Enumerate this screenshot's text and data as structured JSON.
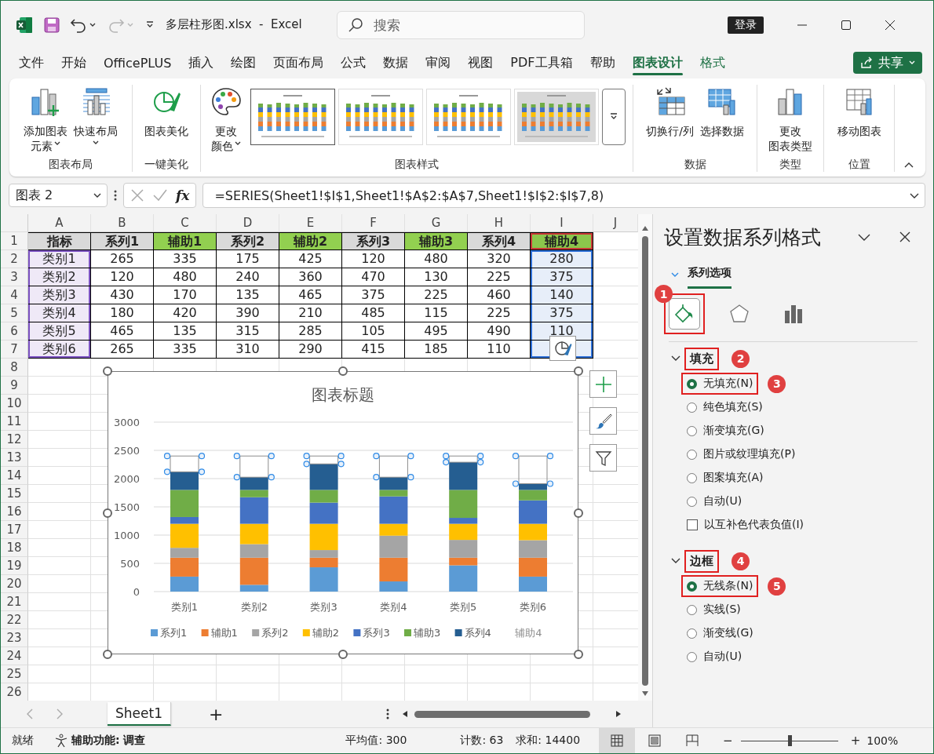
{
  "window": {
    "title": "多层柱形图.xlsx  -  Excel",
    "redo_disabled": true,
    "search": {
      "placeholder": "搜索"
    },
    "sign_in": "登录"
  },
  "menu": {
    "tabs": [
      {
        "label": "文件",
        "selected": false,
        "kind": "normal"
      },
      {
        "label": "开始",
        "selected": false,
        "kind": "normal"
      },
      {
        "label": "OfficePLUS",
        "selected": false,
        "kind": "normal"
      },
      {
        "label": "插入",
        "selected": false,
        "kind": "normal"
      },
      {
        "label": "绘图",
        "selected": false,
        "kind": "normal"
      },
      {
        "label": "页面布局",
        "selected": false,
        "kind": "normal"
      },
      {
        "label": "公式",
        "selected": false,
        "kind": "normal"
      },
      {
        "label": "数据",
        "selected": false,
        "kind": "normal"
      },
      {
        "label": "审阅",
        "selected": false,
        "kind": "normal"
      },
      {
        "label": "视图",
        "selected": false,
        "kind": "normal"
      },
      {
        "label": "PDF工具箱",
        "selected": false,
        "kind": "normal"
      },
      {
        "label": "帮助",
        "selected": false,
        "kind": "normal"
      },
      {
        "label": "图表设计",
        "selected": true,
        "kind": "contextual"
      },
      {
        "label": "格式",
        "selected": false,
        "kind": "contextual"
      }
    ],
    "share": "共享"
  },
  "ribbon": {
    "groups": [
      {
        "label": "图表布局",
        "buttons": [
          {
            "kind": "add-element",
            "lines": [
              "添加图表",
              "元素"
            ],
            "dropdown": true
          },
          {
            "kind": "quick-layout",
            "lines": [
              "快速布局"
            ],
            "dropdown": true
          }
        ]
      },
      {
        "label": "一键美化",
        "buttons": [
          {
            "kind": "beautify",
            "lines": [
              "图表美化"
            ],
            "dropdown": false
          }
        ]
      },
      {
        "label": "图表样式",
        "buttons": [
          {
            "kind": "color",
            "lines": [
              "更改",
              "颜色"
            ],
            "dropdown": true
          }
        ],
        "gallery": [
          {
            "selected": true
          },
          {
            "selected": false
          },
          {
            "selected": false
          },
          {
            "selected": false
          }
        ]
      },
      {
        "label": "数据",
        "buttons": [
          {
            "kind": "switch",
            "lines": [
              "切换行/列"
            ],
            "dropdown": false
          },
          {
            "kind": "select-data",
            "lines": [
              "选择数据"
            ],
            "dropdown": false
          }
        ]
      },
      {
        "label": "类型",
        "buttons": [
          {
            "kind": "change-type",
            "lines": [
              "更改",
              "图表类型"
            ],
            "dropdown": false
          }
        ]
      },
      {
        "label": "位置",
        "buttons": [
          {
            "kind": "move-chart",
            "lines": [
              "移动图表"
            ],
            "dropdown": false
          }
        ]
      }
    ]
  },
  "formula_bar": {
    "name_box": "图表 2",
    "function_label": "fx",
    "formula": "=SERIES(Sheet1!$I$1,Sheet1!$A$2:$A$7,Sheet1!$I$2:$I$7,8)"
  },
  "table": {
    "columns": [
      {
        "label": "A",
        "kind": "category-range"
      },
      {
        "label": "B"
      },
      {
        "label": "C"
      },
      {
        "label": "D"
      },
      {
        "label": "E"
      },
      {
        "label": "F"
      },
      {
        "label": "G"
      },
      {
        "label": "H"
      },
      {
        "label": "I",
        "kind": "value-range"
      },
      {
        "label": "J"
      }
    ],
    "header": {
      "num": "1",
      "cells": [
        {
          "text": "指标",
          "color": "#d9d9d9"
        },
        {
          "text": "系列1",
          "color": "#d9d9d9"
        },
        {
          "text": "辅助1",
          "color": "#92d050"
        },
        {
          "text": "系列2",
          "color": "#d9d9d9"
        },
        {
          "text": "辅助2",
          "color": "#92d050"
        },
        {
          "text": "系列3",
          "color": "#d9d9d9"
        },
        {
          "text": "辅助3",
          "color": "#92d050"
        },
        {
          "text": "系列4",
          "color": "#d9d9d9"
        },
        {
          "text": "辅助4",
          "color": "#92d050"
        }
      ]
    },
    "rows": [
      {
        "num": "2",
        "cells": [
          "类别1",
          "265",
          "335",
          "175",
          "425",
          "120",
          "480",
          "320",
          "280"
        ]
      },
      {
        "num": "3",
        "cells": [
          "类别2",
          "120",
          "480",
          "240",
          "360",
          "470",
          "130",
          "225",
          "375"
        ]
      },
      {
        "num": "4",
        "cells": [
          "类别3",
          "430",
          "170",
          "135",
          "465",
          "375",
          "225",
          "460",
          "140"
        ]
      },
      {
        "num": "5",
        "cells": [
          "类别4",
          "180",
          "420",
          "390",
          "210",
          "485",
          "115",
          "225",
          "375"
        ]
      },
      {
        "num": "6",
        "cells": [
          "类别5",
          "465",
          "135",
          "315",
          "285",
          "105",
          "495",
          "490",
          "110"
        ]
      },
      {
        "num": "7",
        "cells": [
          "类别6",
          "265",
          "335",
          "310",
          "290",
          "415",
          "185",
          "110"
        ]
      }
    ],
    "empty_rows": [
      "8",
      "9",
      "10",
      "11",
      "12",
      "13",
      "14",
      "15",
      "16",
      "17",
      "18",
      "19",
      "20",
      "21",
      "22",
      "23",
      "24",
      "25",
      "26"
    ]
  },
  "chart": {
    "series_filled": [
      true,
      true,
      true,
      true,
      true,
      true,
      true,
      false
    ],
    "chart_data": {
      "type": "bar",
      "stacked": true,
      "grid": true,
      "legend": true,
      "title": "图表标题",
      "categories": [
        "类别1",
        "类别2",
        "类别3",
        "类别4",
        "类别5",
        "类别6"
      ],
      "ylim": [
        0,
        3000
      ],
      "yticks": [
        0,
        500,
        1000,
        1500,
        2000,
        2500,
        3000
      ],
      "series": [
        {
          "name": "系列1",
          "color": "#5b9bd5",
          "values": [
            265,
            120,
            430,
            180,
            465,
            265
          ]
        },
        {
          "name": "辅助1",
          "color": "#ed7d31",
          "values": [
            335,
            480,
            170,
            420,
            135,
            335
          ]
        },
        {
          "name": "系列2",
          "color": "#a5a5a5",
          "values": [
            175,
            240,
            135,
            390,
            315,
            310
          ]
        },
        {
          "name": "辅助2",
          "color": "#ffc000",
          "values": [
            425,
            360,
            465,
            210,
            285,
            290
          ]
        },
        {
          "name": "系列3",
          "color": "#4472c4",
          "values": [
            120,
            470,
            375,
            485,
            105,
            415
          ]
        },
        {
          "name": "辅助3",
          "color": "#70ad47",
          "values": [
            480,
            130,
            225,
            115,
            495,
            185
          ]
        },
        {
          "name": "系列4",
          "color": "#255e91",
          "values": [
            320,
            225,
            460,
            225,
            490,
            110
          ]
        },
        {
          "name": "辅助4",
          "color": "#8c8c8c",
          "values": [
            280,
            375,
            140,
            375,
            110,
            490
          ]
        }
      ]
    }
  },
  "panel": {
    "title": "设置数据系列格式",
    "tabs": [
      {
        "label": "系列选项",
        "selected": true
      }
    ],
    "icon_tabs": [
      {
        "kind": "fill",
        "selected": true,
        "badge": "1"
      },
      {
        "kind": "effects",
        "selected": false
      },
      {
        "kind": "series-options",
        "selected": false
      }
    ],
    "sections": [
      {
        "label": "填充",
        "expanded": true,
        "badge": "2",
        "options": [
          {
            "kind": "radio",
            "label": "无填充(N)",
            "selected": true,
            "badge": "3"
          },
          {
            "kind": "radio",
            "label": "纯色填充(S)",
            "selected": false
          },
          {
            "kind": "radio",
            "label": "渐变填充(G)",
            "selected": false
          },
          {
            "kind": "radio",
            "label": "图片或纹理填充(P)",
            "selected": false
          },
          {
            "kind": "radio",
            "label": "图案填充(A)",
            "selected": false
          },
          {
            "kind": "radio",
            "label": "自动(U)",
            "selected": false
          },
          {
            "kind": "checkbox",
            "label": "以互补色代表负值(I)",
            "checked": false
          }
        ]
      },
      {
        "label": "边框",
        "expanded": true,
        "badge": "4",
        "options": [
          {
            "kind": "radio",
            "label": "无线条(N)",
            "selected": true,
            "badge": "5"
          },
          {
            "kind": "radio",
            "label": "实线(S)",
            "selected": false
          },
          {
            "kind": "radio",
            "label": "渐变线(G)",
            "selected": false
          },
          {
            "kind": "radio",
            "label": "自动(U)",
            "selected": false
          }
        ]
      }
    ]
  },
  "sheet_tabs": {
    "sheets": [
      {
        "label": "Sheet1",
        "selected": true
      }
    ],
    "add": "+"
  },
  "status_bar": {
    "status": "就绪",
    "accessibility": "辅助功能: 调查",
    "stats": [
      "平均值: 300",
      "计数: 63",
      "求和: 14400"
    ],
    "views": [
      {
        "kind": "normal",
        "selected": true
      },
      {
        "kind": "page-layout",
        "selected": false
      },
      {
        "kind": "page-break",
        "selected": false
      }
    ],
    "zoom": {
      "minus": "−",
      "plus": "+",
      "level": 0.5,
      "value": "100%"
    }
  }
}
